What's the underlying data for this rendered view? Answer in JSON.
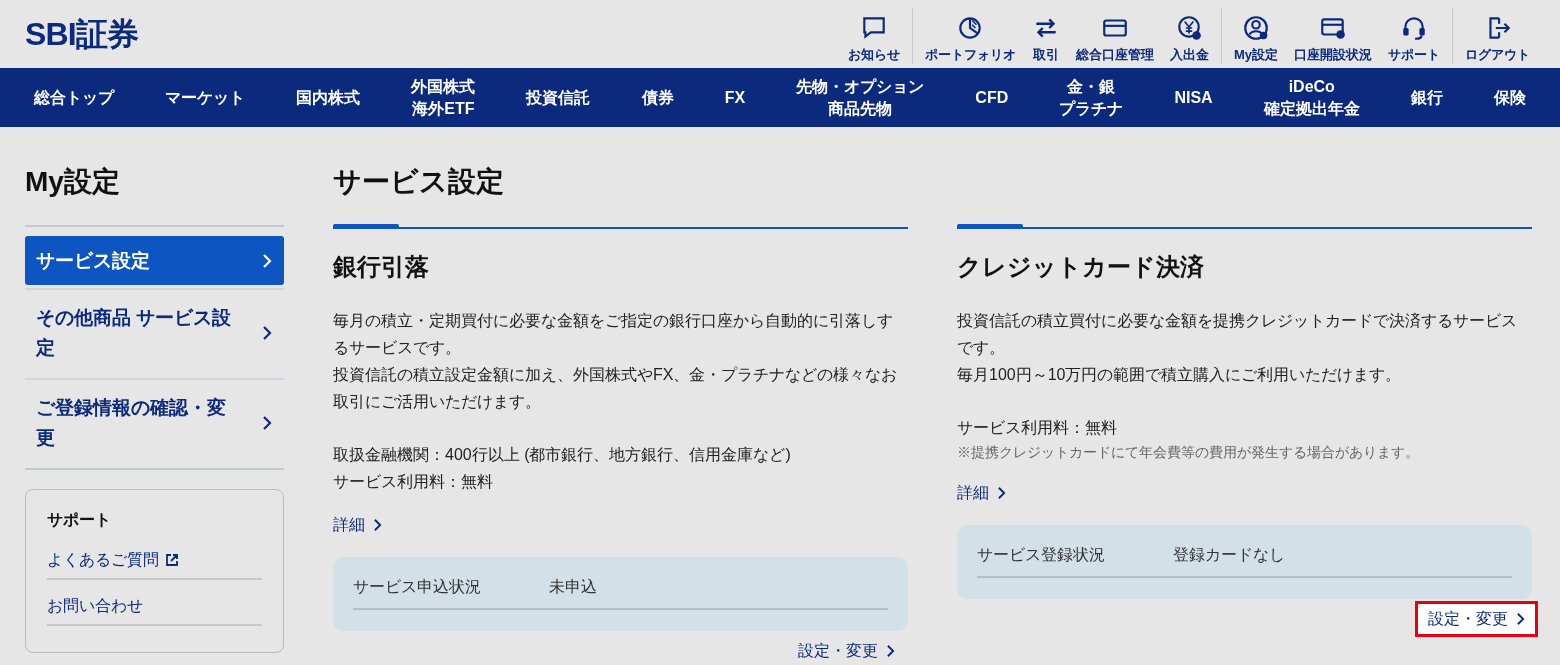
{
  "header": {
    "logo": "SBI証券",
    "utility_groups": [
      [
        {
          "kind": "chat",
          "label": "お知らせ"
        }
      ],
      [
        {
          "kind": "pie",
          "label": "ポートフォリオ"
        },
        {
          "kind": "arrows",
          "label": "取引"
        },
        {
          "kind": "card",
          "label": "総合口座管理"
        },
        {
          "kind": "yen",
          "label": "入出金"
        }
      ],
      [
        {
          "kind": "user",
          "label": "My設定"
        },
        {
          "kind": "cardplus",
          "label": "口座開設状況"
        },
        {
          "kind": "headset",
          "label": "サポート"
        }
      ],
      [
        {
          "kind": "logout",
          "label": "ログアウト"
        }
      ]
    ]
  },
  "nav": [
    {
      "lines": [
        "総合トップ"
      ]
    },
    {
      "lines": [
        "マーケット"
      ]
    },
    {
      "lines": [
        "国内株式"
      ]
    },
    {
      "lines": [
        "外国株式",
        "海外ETF"
      ]
    },
    {
      "lines": [
        "投資信託"
      ]
    },
    {
      "lines": [
        "債券"
      ]
    },
    {
      "lines": [
        "FX"
      ]
    },
    {
      "lines": [
        "先物・オプション",
        "商品先物"
      ]
    },
    {
      "lines": [
        "CFD"
      ]
    },
    {
      "lines": [
        "金・銀",
        "プラチナ"
      ]
    },
    {
      "lines": [
        "NISA"
      ]
    },
    {
      "lines": [
        "iDeCo",
        "確定拠出年金"
      ]
    },
    {
      "lines": [
        "銀行"
      ]
    },
    {
      "lines": [
        "保険"
      ]
    }
  ],
  "sidebar": {
    "title": "My設定",
    "items": [
      {
        "label": "サービス設定",
        "selected": true
      },
      {
        "label": "その他商品 サービス設定",
        "selected": false
      },
      {
        "label": "ご登録情報の確認・変更",
        "selected": false
      }
    ],
    "support": {
      "title": "サポート",
      "links": [
        {
          "label": "よくあるご質問",
          "external": true
        },
        {
          "label": "お問い合わせ",
          "external": false
        }
      ]
    }
  },
  "main": {
    "title": "サービス設定",
    "cards": [
      {
        "title": "銀行引落",
        "blocks": [
          [
            {
              "kind": "text",
              "text": "毎月の積立・定期買付に必要な金額をご指定の銀行口座から自動的に引落しするサービスです。"
            },
            {
              "kind": "text",
              "text": "投資信託の積立設定金額に加え、外国株式やFX、金・プラチナなどの様々なお取引にご活用いただけます。"
            }
          ],
          [
            {
              "kind": "text",
              "text": "取扱金融機関：400行以上 (都市銀行、地方銀行、信用金庫など)"
            },
            {
              "kind": "text",
              "text": "サービス利用料：無料"
            }
          ]
        ],
        "details_link": "詳細",
        "status": {
          "label": "サービス申込状況",
          "value": "未申込"
        },
        "action": {
          "label": "設定・変更",
          "highlighted": false
        }
      },
      {
        "title": "クレジットカード決済",
        "blocks": [
          [
            {
              "kind": "text",
              "text": "投資信託の積立買付に必要な金額を提携クレジットカードで決済するサービスです。"
            },
            {
              "kind": "text",
              "text": "毎月100円～10万円の範囲で積立購入にご利用いただけます。"
            }
          ],
          [
            {
              "kind": "text",
              "text": "サービス利用料：無料"
            },
            {
              "kind": "note",
              "text": "※提携クレジットカードにて年会費等の費用が発生する場合があります。"
            }
          ]
        ],
        "details_link": "詳細",
        "status": {
          "label": "サービス登録状況",
          "value": "登録カードなし"
        },
        "action": {
          "label": "設定・変更",
          "highlighted": true
        }
      }
    ]
  }
}
